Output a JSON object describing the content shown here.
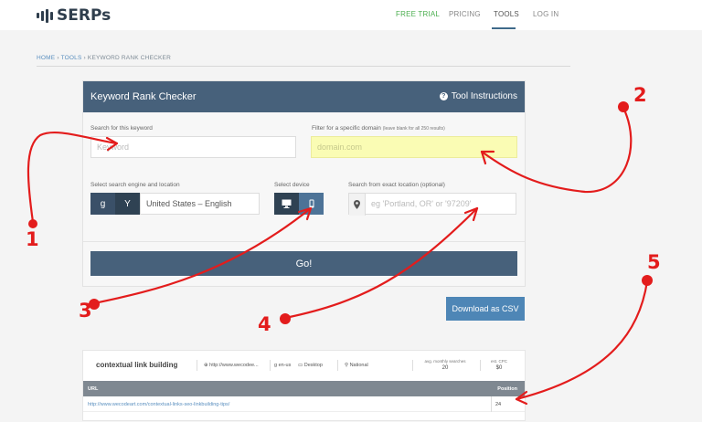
{
  "header": {
    "logo_text": "SERPs",
    "nav": {
      "free_trial": "FREE TRIAL",
      "pricing": "PRICING",
      "tools": "TOOLS",
      "login": "LOG IN"
    }
  },
  "breadcrumb": {
    "home": "HOME",
    "tools": "TOOLS",
    "current": "KEYWORD RANK CHECKER",
    "separator": "›"
  },
  "panel": {
    "title": "Keyword Rank Checker",
    "help_label": "Tool Instructions",
    "keyword_label": "Search for this keyword",
    "keyword_placeholder": "Keyword",
    "domain_label": "Filter for a specific domain",
    "domain_hint": "(leave blank for all 250 results)",
    "domain_placeholder": "domain.com",
    "engine_label": "Select search engine and location",
    "engine_google": "g",
    "engine_yahoo": "Y",
    "location_value": "United States – English",
    "device_label": "Select device",
    "exact_location_label": "Search from exact location (optional)",
    "exact_location_placeholder": "eg 'Portland, OR' or '97209'",
    "go_label": "Go!"
  },
  "download_csv_label": "Download as CSV",
  "results": {
    "keyword": "contextual link building",
    "domain": "http://www.wecodee...",
    "lang": "en-us",
    "device": "Desktop",
    "scope": "National",
    "monthly_searches_label": "avg. monthly searches",
    "monthly_searches_value": "20",
    "cpc_label": "est. CPC",
    "cpc_value": "$0",
    "columns": {
      "url": "URL",
      "position": "Position"
    },
    "rows": [
      {
        "url": "http://www.wecodeart.com/contextual-links-seo-linkbuilding-tips/",
        "position": "24"
      }
    ]
  },
  "annotations": [
    "1",
    "2",
    "3",
    "4",
    "5"
  ],
  "colors": {
    "header_bar": "#47617b",
    "accent_blue": "#4e86b6",
    "annotation_red": "#e31c1c",
    "highlight_yellow": "#fafcb4",
    "nav_green": "#4caf50"
  }
}
